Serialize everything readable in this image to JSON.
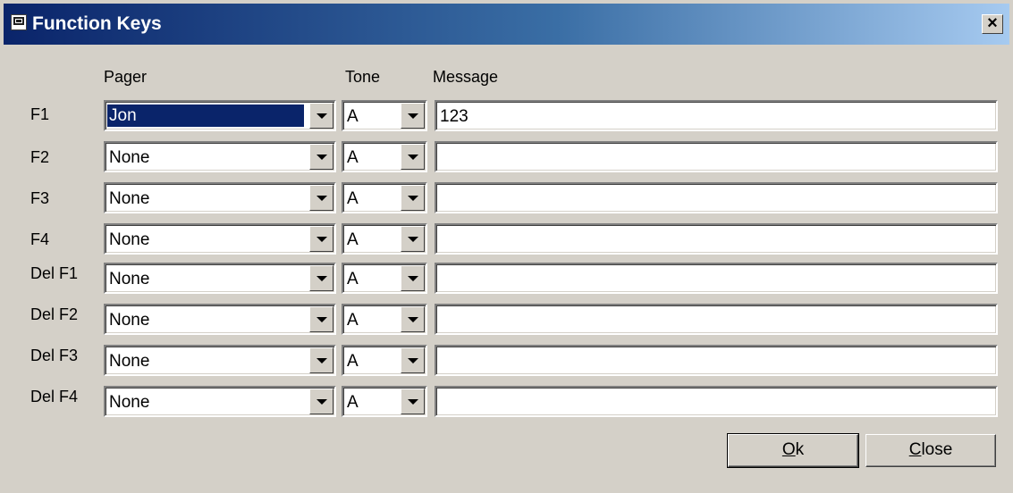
{
  "window": {
    "title": "Function Keys",
    "close_glyph": "×"
  },
  "columns": {
    "pager": "Pager",
    "tone": "Tone",
    "message": "Message"
  },
  "rows": [
    {
      "key": "F1",
      "pager": "Jon",
      "tone": "A",
      "message": "123",
      "selected": true
    },
    {
      "key": "F2",
      "pager": "None",
      "tone": "A",
      "message": ""
    },
    {
      "key": "F3",
      "pager": "None",
      "tone": "A",
      "message": ""
    },
    {
      "key": "F4",
      "pager": "None",
      "tone": "A",
      "message": ""
    },
    {
      "key": "Del F1",
      "pager": "None",
      "tone": "A",
      "message": ""
    },
    {
      "key": "Del F2",
      "pager": "None",
      "tone": "A",
      "message": ""
    },
    {
      "key": "Del F3",
      "pager": "None",
      "tone": "A",
      "message": ""
    },
    {
      "key": "Del F4",
      "pager": "None",
      "tone": "A",
      "message": ""
    }
  ],
  "buttons": {
    "ok": {
      "mnemonic": "O",
      "rest": "k"
    },
    "close": {
      "mnemonic": "C",
      "rest": "lose"
    }
  },
  "colors": {
    "title_start": "#0a246a",
    "title_end": "#a6caf0",
    "face": "#d4d0c8",
    "selection": "#0a246a"
  },
  "icons": {
    "title": "window-app-icon",
    "dropdown": "chevron-down-icon"
  }
}
